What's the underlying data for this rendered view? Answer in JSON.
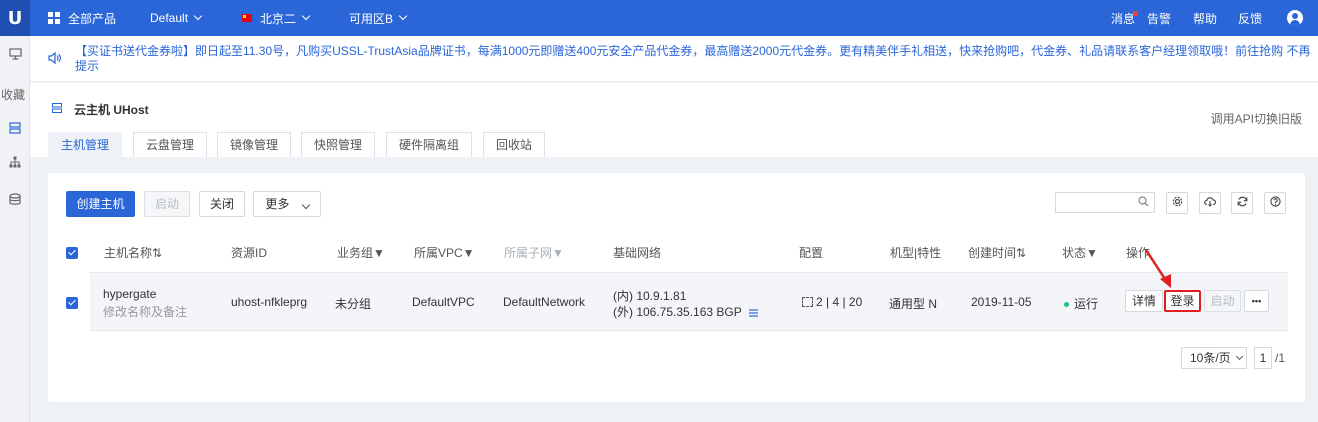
{
  "topbar": {
    "logo": "U",
    "all_products": "全部产品",
    "project": "Default",
    "region": "北京二",
    "zone": "可用区B",
    "messages": "消息",
    "alerts": "告警",
    "help": "帮助",
    "feedback": "反馈"
  },
  "sidebar": {
    "favorites_label": "收藏"
  },
  "notice": {
    "text": "【买证书送代金券啦】即日起至11.30号，凡购买USSL-TrustAsia品牌证书，每满1000元即赠送400元安全产品代金券，最高赠送2000元代金券。更有精美伴手礼相送，快来抢购吧，代金券、礼品请联系客户经理领取哦！前往抢购",
    "dismiss": "不再提示"
  },
  "header": {
    "title": "云主机 UHost",
    "api_link": "调用API切换旧版"
  },
  "tabs": [
    {
      "label": "主机管理"
    },
    {
      "label": "云盘管理"
    },
    {
      "label": "镜像管理"
    },
    {
      "label": "快照管理"
    },
    {
      "label": "硬件隔离组"
    },
    {
      "label": "回收站"
    }
  ],
  "toolbar": {
    "create": "创建主机",
    "start": "启动",
    "stop": "关闭",
    "more": "更多"
  },
  "table": {
    "columns": [
      "主机名称⇅",
      "资源ID",
      "业务组▼",
      "所属VPC▼",
      "所属子网▼",
      "基础网络",
      "配置",
      "机型|特性",
      "创建时间⇅",
      "状态▼",
      "操作"
    ],
    "rows": [
      {
        "name": "hypergate",
        "name_sub": "修改名称及备注",
        "resource_id": "uhost-nfkleprg",
        "group": "未分组",
        "vpc": "DefaultVPC",
        "subnet": "DefaultNetwork",
        "ip_internal": "(内) 10.9.1.81",
        "ip_external": "(外) 106.75.35.163 BGP",
        "config": "2 | 4 | 20",
        "type": "通用型 N",
        "created": "2019-11-05",
        "status": "运行",
        "actions": {
          "detail": "详情",
          "login": "登录",
          "start": "启动",
          "more": "•••"
        }
      }
    ]
  },
  "pager": {
    "page_size": "10条/页",
    "page": "1",
    "total": "/1"
  },
  "colors": {
    "primary": "#2a66d8",
    "running": "#19c37d",
    "highlight": "#e02020"
  }
}
